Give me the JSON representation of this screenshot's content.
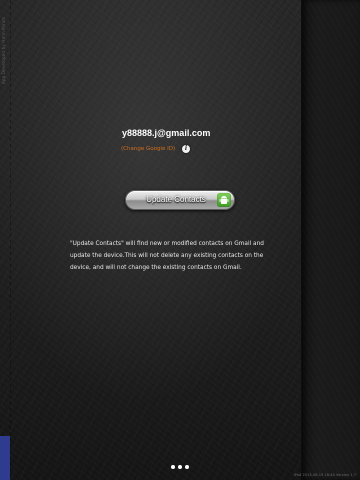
{
  "account": {
    "email": "y88888.j@gmail.com",
    "change_link": "(Change Google ID)"
  },
  "actions": {
    "update_label": "Update Contacts",
    "update_icon": "android-icon"
  },
  "description": "\"Update Contacts\" will find new or modified contacts on Gmail and update the device.This will not delete any existing contacts on the device, and will not change the existing contacts on Gmail.",
  "side_credit": "App Developed by Hmm Moum",
  "footer": {
    "build": "iPad 2013-06-19 16:44 Version 1.7"
  },
  "pager": {
    "page_count": 3
  },
  "colors": {
    "link": "#d1701f",
    "side_tab": "#2f3b8f",
    "button_icon": "#4caf2e"
  }
}
